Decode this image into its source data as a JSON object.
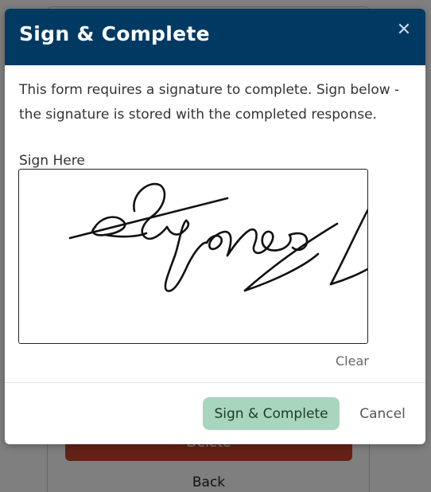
{
  "background": {
    "delete_label": "Delete",
    "back_label": "Back"
  },
  "modal": {
    "title": "Sign & Complete",
    "close_icon": "close-icon",
    "intro_text": "This form requires a signature to complete. Sign below - the signature is stored with the completed response.",
    "sign_label": "Sign Here",
    "clear_label": "Clear",
    "submit_label": "Sign & Complete",
    "cancel_label": "Cancel"
  },
  "colors": {
    "header": "#003a63",
    "submit_button": "#a8d5bd",
    "delete_button": "#c9452f"
  }
}
